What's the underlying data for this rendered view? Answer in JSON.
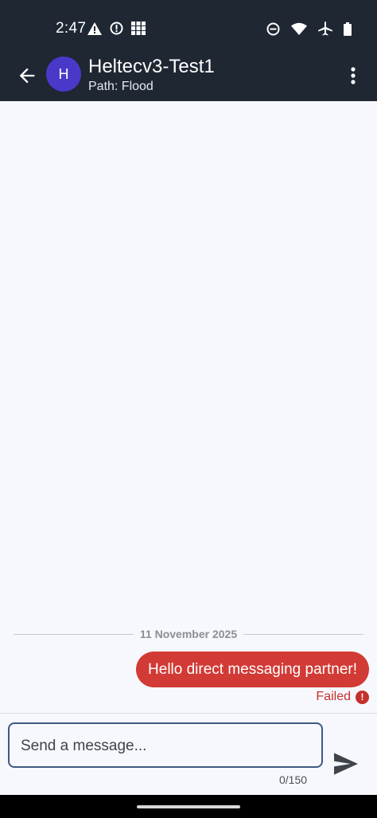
{
  "status_bar": {
    "time": "2:47",
    "left_icons": [
      "warning-icon",
      "alert-circle-icon",
      "grid-icon"
    ],
    "right_icons": [
      "do-not-disturb-icon",
      "wifi-icon",
      "airplane-icon",
      "battery-icon"
    ]
  },
  "app_bar": {
    "avatar_letter": "H",
    "title": "Heltecv3-Test1",
    "subtitle": "Path: Flood",
    "avatar_color": "#4a39c9",
    "background_color": "#1f2733"
  },
  "messages": {
    "date_separator": "11 November 2025",
    "items": [
      {
        "text": "Hello direct messaging partner!",
        "status": "Failed",
        "outgoing": true,
        "bubble_color": "#d23a35"
      }
    ]
  },
  "composer": {
    "placeholder": "Send a message...",
    "value": "",
    "counter": "0/150"
  }
}
